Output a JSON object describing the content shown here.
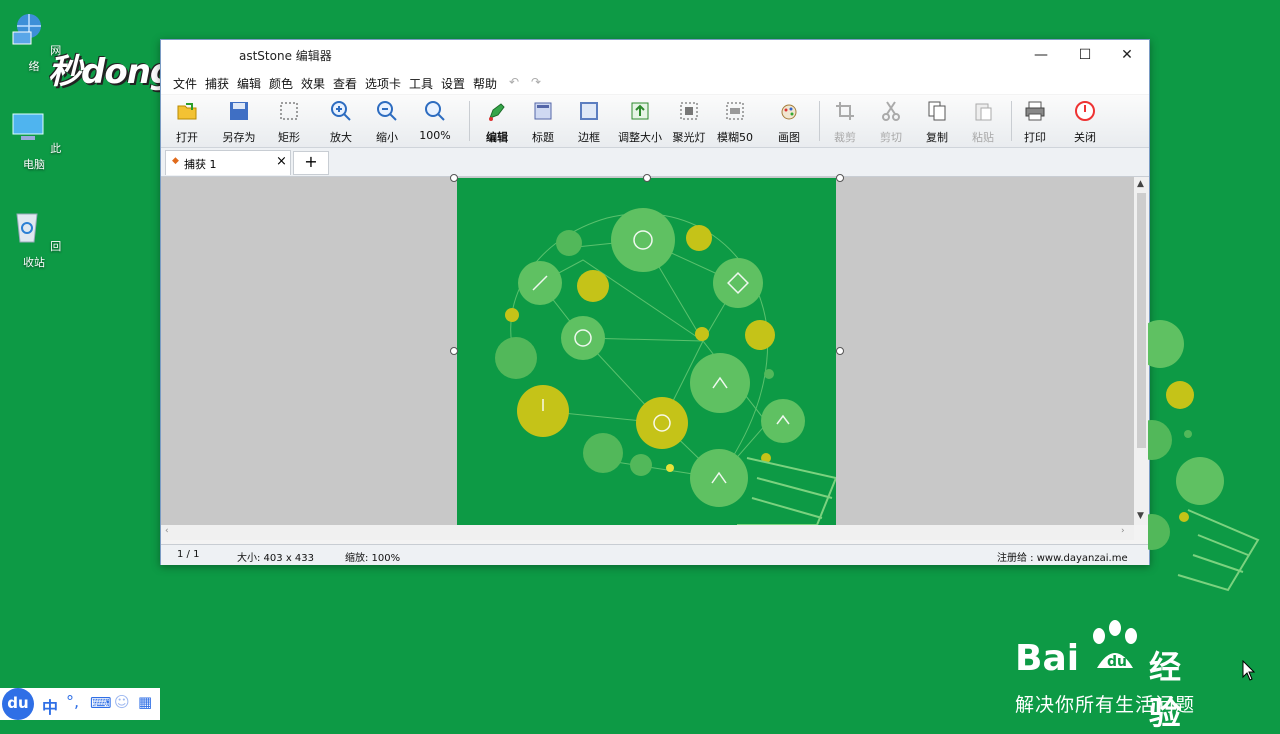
{
  "desktop": {
    "icons": [
      {
        "label": "网络",
        "icon": "network-icon"
      },
      {
        "label": "此电脑",
        "icon": "computer-icon"
      },
      {
        "label": "回收站",
        "icon": "recycle-bin-icon"
      }
    ],
    "watermark": "秒dong视频"
  },
  "window": {
    "title": "astStone 编辑器",
    "menu": [
      "文件",
      "捕获",
      "编辑",
      "颜色",
      "效果",
      "查看",
      "选项卡",
      "工具",
      "设置",
      "帮助"
    ],
    "toolbar": [
      {
        "label": "打开",
        "icon": "open-folder-icon"
      },
      {
        "label": "另存为",
        "icon": "save-icon"
      },
      {
        "label": "矩形",
        "icon": "rectangle-select-icon"
      },
      {
        "label": "放大",
        "icon": "zoom-in-icon"
      },
      {
        "label": "缩小",
        "icon": "zoom-out-icon"
      },
      {
        "label": "100%",
        "icon": "zoom-100-icon"
      },
      {
        "label": "编辑",
        "icon": "edit-icon"
      },
      {
        "label": "标题",
        "icon": "caption-icon"
      },
      {
        "label": "边框",
        "icon": "border-icon"
      },
      {
        "label": "调整大小",
        "icon": "resize-icon"
      },
      {
        "label": "聚光灯",
        "icon": "spotlight-icon"
      },
      {
        "label": "模糊50",
        "icon": "blur-icon"
      },
      {
        "label": "画图",
        "icon": "draw-icon"
      },
      {
        "label": "裁剪",
        "icon": "crop-icon"
      },
      {
        "label": "剪切",
        "icon": "cut-icon"
      },
      {
        "label": "复制",
        "icon": "copy-icon"
      },
      {
        "label": "粘贴",
        "icon": "paste-icon"
      },
      {
        "label": "打印",
        "icon": "print-icon"
      },
      {
        "label": "关闭",
        "icon": "power-icon"
      }
    ],
    "tab": {
      "label": "捕获 1",
      "close": "×",
      "add": "+"
    },
    "status": {
      "page": "1 / 1",
      "size": "大小: 403 x 433",
      "zoom": "缩放: 100%",
      "reg": "注册给 : www.dayanzai.me"
    }
  },
  "ime": {
    "logo": "du",
    "lang": "中"
  },
  "baidu": {
    "brand": "Bai",
    "brand2": "经验",
    "slogan": "解决你所有生活问题"
  },
  "colors": {
    "desktop": "#0d9a45",
    "accent": "#c5c318"
  }
}
